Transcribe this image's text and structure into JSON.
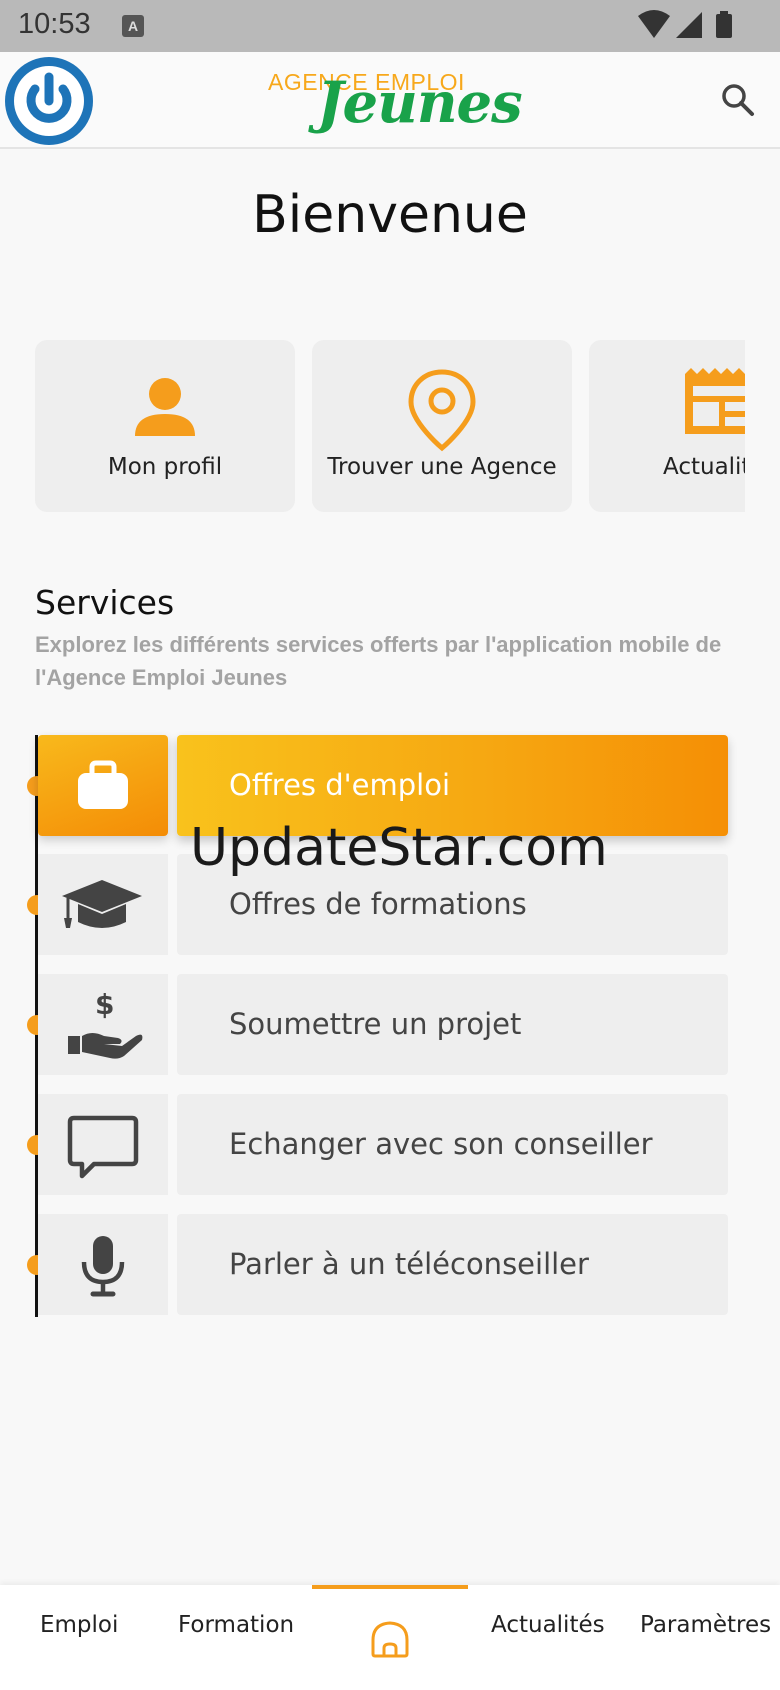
{
  "status_bar": {
    "time": "10:53",
    "badge": "A",
    "icons": [
      "wifi-icon",
      "signal-icon",
      "battery-icon"
    ]
  },
  "app_bar": {
    "logo_top": "AGENCE EMPLOI",
    "logo_main": "Jeunes",
    "power_icon": "power-icon",
    "search_icon": "search-icon"
  },
  "welcome": "Bienvenue",
  "quick_tiles": [
    {
      "label": "Mon profil",
      "icon": "person-icon"
    },
    {
      "label": "Trouver une Agence",
      "icon": "location-pin-icon"
    },
    {
      "label": "Actualit",
      "icon": "newspaper-icon"
    }
  ],
  "services": {
    "title": "Services",
    "description": "Explorez les différents services offerts par l'application mobile de l'Agence Emploi Jeunes",
    "items": [
      {
        "label": "Offres d'emploi",
        "icon": "briefcase-icon",
        "active": true
      },
      {
        "label": "Offres de formations",
        "icon": "graduation-cap-icon",
        "active": false
      },
      {
        "label": "Soumettre un projet",
        "icon": "hand-money-icon",
        "active": false
      },
      {
        "label": "Echanger avec son conseiller",
        "icon": "chat-bubble-icon",
        "active": false
      },
      {
        "label": "Parler à un téléconseiller",
        "icon": "microphone-icon",
        "active": false
      }
    ]
  },
  "watermark": "UpdateStar.com",
  "bottom_nav": {
    "items": [
      {
        "label": "Emploi"
      },
      {
        "label": "Formation"
      },
      {
        "label": "",
        "icon": "home-icon",
        "active": true
      },
      {
        "label": "Actualités"
      },
      {
        "label": "Paramètres"
      }
    ]
  },
  "colors": {
    "accent_orange": "#f59d1c",
    "brand_blue": "#1e74b8",
    "brand_green": "#19a24a",
    "logo_yellow": "#f7a81b"
  }
}
